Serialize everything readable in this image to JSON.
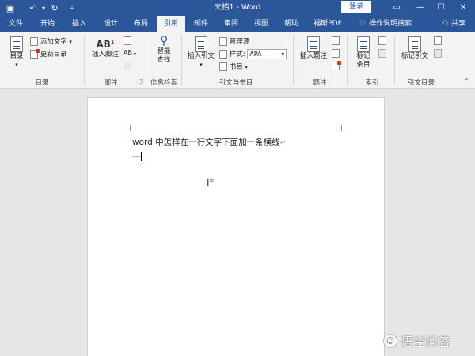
{
  "titlebar": {
    "save_icon": "save-icon",
    "undo_icon": "undo-icon",
    "redo_icon": "redo-icon",
    "customize_icon": "customize-icon",
    "title": "文档1 - Word",
    "login": "登录",
    "restore_icon": "restore-icon",
    "minimize_icon": "minimize-icon",
    "maximize_icon": "maximize-icon",
    "close_icon": "close-icon"
  },
  "tabs": {
    "file": "文件",
    "home": "开始",
    "insert": "插入",
    "design": "设计",
    "layout": "布局",
    "references": "引用",
    "mailings": "邮件",
    "review": "审阅",
    "view": "视图",
    "help": "帮助",
    "foxit": "福昕PDF",
    "tellme": "操作说明搜索",
    "share": "共享"
  },
  "ribbon": {
    "toc": {
      "big_label": "目录",
      "add_text": "添加文字",
      "update_toc": "更新目录",
      "group_label": "目录"
    },
    "footnotes": {
      "big_label": "插入脚注",
      "group_label": "脚注"
    },
    "research": {
      "big_label_1": "智能",
      "big_label_2": "查找",
      "group_label": "信息检索"
    },
    "citations": {
      "big_label": "插入引文",
      "manage_sources": "管理源",
      "style_label": "样式:",
      "style_value": "APA",
      "bibliography": "书目",
      "group_label": "引文与书目"
    },
    "captions": {
      "big_label": "插入题注",
      "group_label": "题注"
    },
    "index": {
      "big_label_1": "标记",
      "big_label_2": "条目",
      "group_label": "索引"
    },
    "authorities": {
      "big_label": "标记引文",
      "group_label": "引文目录"
    }
  },
  "document": {
    "line1": "word 中怎样在一行文字下面加一条横线",
    "line1_mark": "↵",
    "line2": "---"
  },
  "watermark": {
    "text": "悟空问答"
  },
  "colors": {
    "titlebar_bg": "#2b579a",
    "ribbon_bg": "#f3f3f3",
    "doc_bg": "#e6e6e6"
  }
}
